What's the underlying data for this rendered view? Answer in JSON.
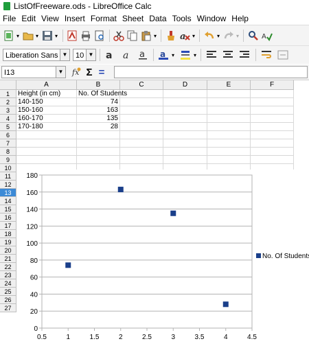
{
  "window": {
    "title": "ListOfFreeware.ods - LibreOffice Calc"
  },
  "menu": [
    "File",
    "Edit",
    "View",
    "Insert",
    "Format",
    "Sheet",
    "Data",
    "Tools",
    "Window",
    "Help"
  ],
  "format_toolbar": {
    "font_name": "Liberation Sans",
    "font_size": "10"
  },
  "formula_bar": {
    "name_box": "I13",
    "formula": ""
  },
  "columns": [
    "A",
    "B",
    "C",
    "D",
    "E",
    "F"
  ],
  "rows": [
    "1",
    "2",
    "3",
    "4",
    "5",
    "6",
    "7",
    "8",
    "9",
    "10",
    "11",
    "12",
    "13",
    "14",
    "15",
    "16",
    "17",
    "18",
    "19",
    "20",
    "21",
    "22",
    "23",
    "24",
    "25",
    "26",
    "27"
  ],
  "selected_row": "13",
  "cells": {
    "A1": "Height (in cm)",
    "B1": "No. Of Students",
    "A2": "140-150",
    "B2": "74",
    "A3": "150-160",
    "B3": "163",
    "A4": "160-170",
    "B4": "135",
    "A5": "170-180",
    "B5": "28"
  },
  "colors": {
    "point": "#1a3f8a",
    "header_bg": "#efefef",
    "selected_header": "#3c8ad6"
  },
  "chart_data": {
    "type": "scatter",
    "series": [
      {
        "name": "No. Of Students",
        "x": [
          1,
          2,
          3,
          4
        ],
        "y": [
          74,
          163,
          135,
          28
        ]
      }
    ],
    "xlim": [
      0.5,
      4.5
    ],
    "ylim": [
      0,
      180
    ],
    "x_ticks": [
      "0.5",
      "1",
      "1.5",
      "2",
      "2.5",
      "3",
      "3.5",
      "4",
      "4.5"
    ],
    "y_ticks": [
      "0",
      "20",
      "40",
      "60",
      "80",
      "100",
      "120",
      "140",
      "160",
      "180"
    ],
    "grid": true,
    "legend": "right"
  }
}
